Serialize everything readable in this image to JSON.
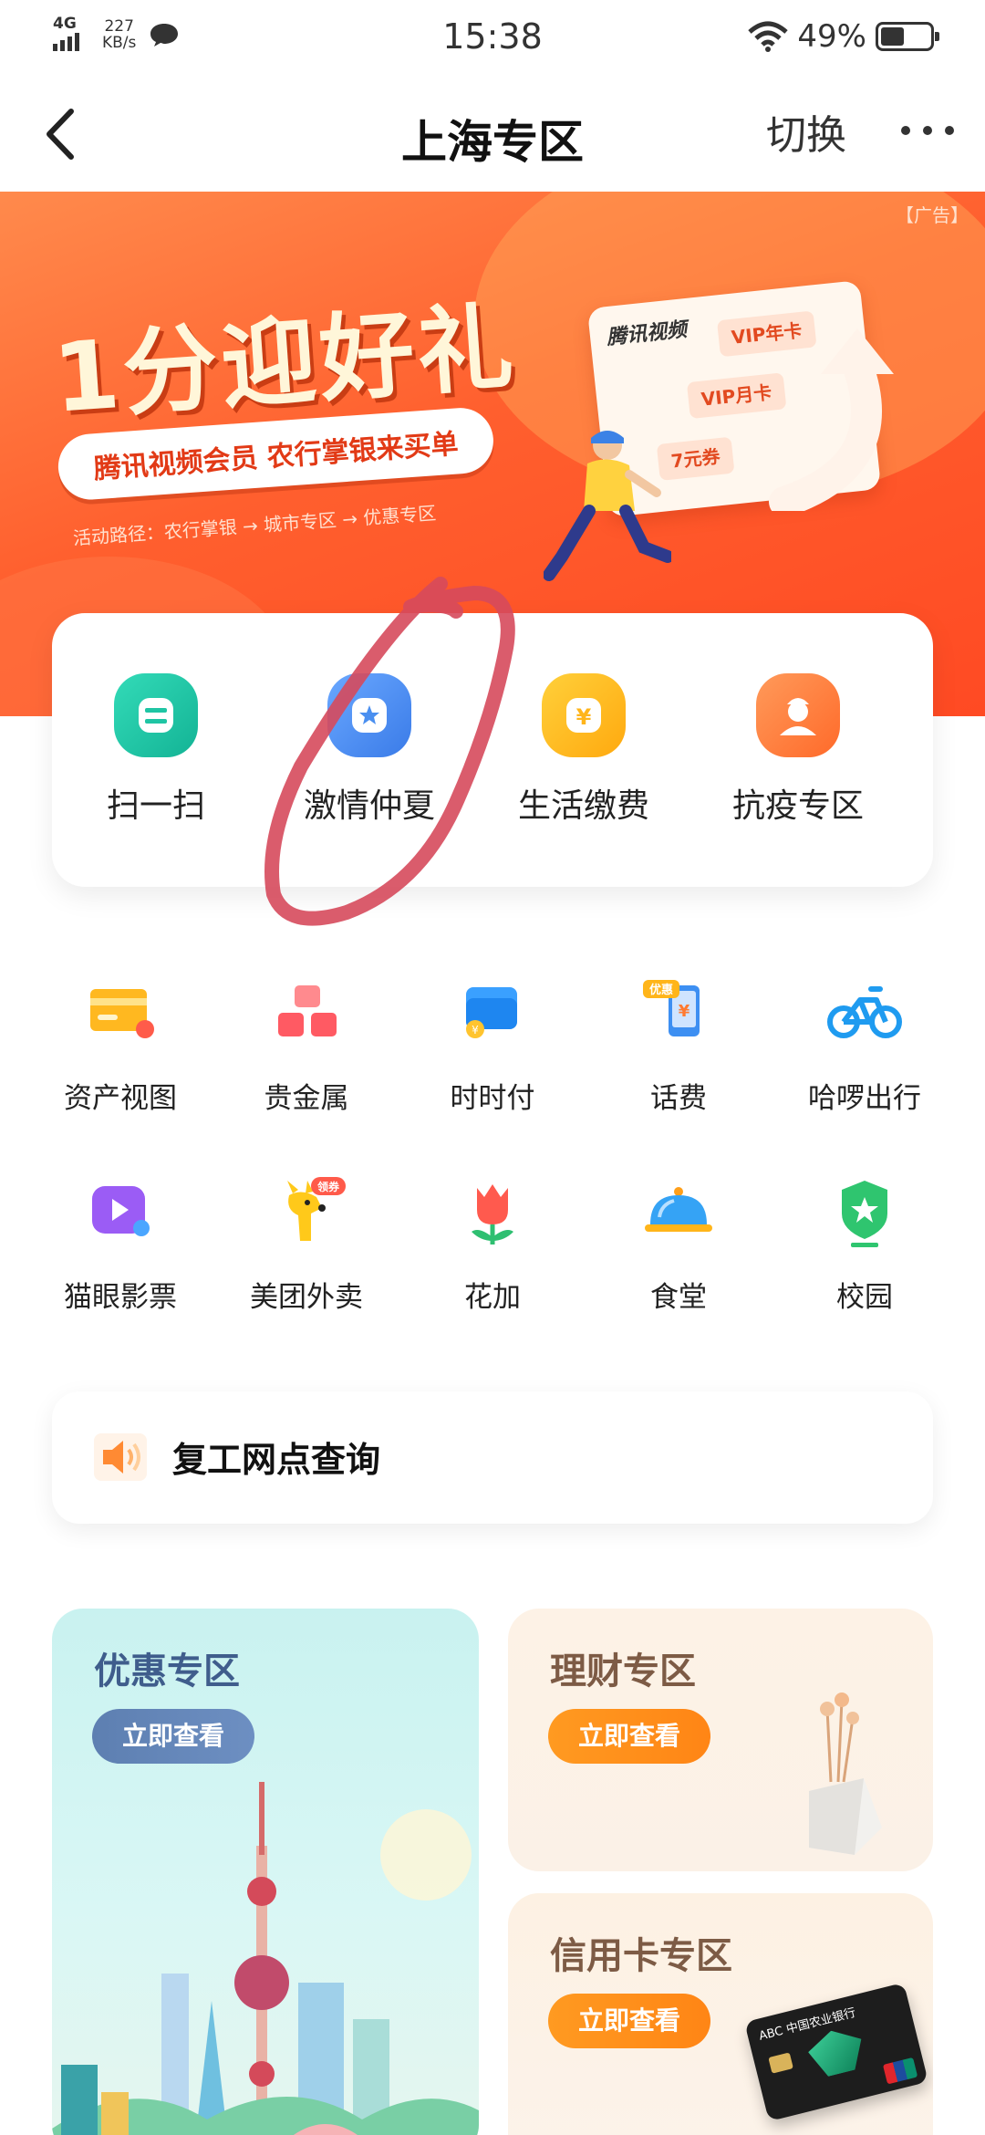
{
  "status_bar": {
    "network": "4G",
    "speed_value": "227",
    "speed_unit": "KB/s",
    "time": "15:38",
    "battery": "49%",
    "battery_level": 0.49
  },
  "nav": {
    "title": "上海专区",
    "switch_label": "切换"
  },
  "banner": {
    "ad_tag": "【广告】",
    "headline": "1分迎好礼",
    "pill": "腾讯视频会员 农行掌银来买单",
    "route": "活动路径：农行掌银 → 城市专区 → 优惠专区",
    "card_logo": "腾讯视频",
    "chips": [
      "VIP年卡",
      "VIP月卡",
      "7元券"
    ]
  },
  "quick_actions": [
    {
      "label": "扫一扫",
      "icon": "scan-icon",
      "color": "#1fc5a4"
    },
    {
      "label": "激情仲夏",
      "icon": "star-icon",
      "color": "#4a8ff0"
    },
    {
      "label": "生活缴费",
      "icon": "yuan-icon",
      "color": "#ffb51a"
    },
    {
      "label": "抗疫专区",
      "icon": "doctor-icon",
      "color": "#ff7a3a"
    }
  ],
  "grid": [
    {
      "label": "资产视图",
      "icon": "card-icon"
    },
    {
      "label": "贵金属",
      "icon": "gold-bars-icon"
    },
    {
      "label": "时时付",
      "icon": "wallet-icon"
    },
    {
      "label": "话费",
      "icon": "phone-bill-icon",
      "badge": "优惠"
    },
    {
      "label": "哈啰出行",
      "icon": "bicycle-icon"
    },
    {
      "label": "猫眼影票",
      "icon": "movie-icon"
    },
    {
      "label": "美团外卖",
      "icon": "kangaroo-icon",
      "badge": "领券"
    },
    {
      "label": "花加",
      "icon": "tulip-icon"
    },
    {
      "label": "食堂",
      "icon": "dish-cover-icon"
    },
    {
      "label": "校园",
      "icon": "shield-star-icon"
    }
  ],
  "notice": {
    "text": "复工网点查询",
    "icon": "speaker-icon"
  },
  "promos": [
    {
      "title": "优惠专区",
      "button": "立即查看"
    },
    {
      "title": "理财专区",
      "button": "立即查看"
    },
    {
      "title": "信用卡专区",
      "button": "立即查看"
    }
  ],
  "credit_card_brand": "ABC 中国农业银行"
}
